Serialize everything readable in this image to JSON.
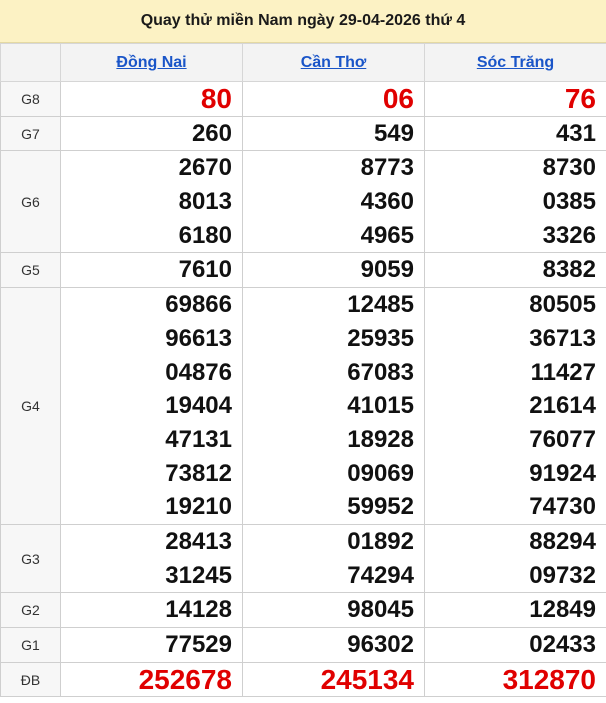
{
  "title": "Quay thử miền Nam ngày 29-04-2026 thứ 4",
  "provinces": [
    "Đồng Nai",
    "Cần Thơ",
    "Sóc Trăng"
  ],
  "accent_color": "#e00000",
  "link_color": "#1a55c8",
  "prizes": [
    {
      "label": "G8",
      "key": "g8",
      "highlight": true,
      "values": [
        [
          "80"
        ],
        [
          "06"
        ],
        [
          "76"
        ]
      ]
    },
    {
      "label": "G7",
      "key": "g7",
      "highlight": false,
      "values": [
        [
          "260"
        ],
        [
          "549"
        ],
        [
          "431"
        ]
      ]
    },
    {
      "label": "G6",
      "key": "g6",
      "highlight": false,
      "values": [
        [
          "2670",
          "8013",
          "6180"
        ],
        [
          "8773",
          "4360",
          "4965"
        ],
        [
          "8730",
          "0385",
          "3326"
        ]
      ]
    },
    {
      "label": "G5",
      "key": "g5",
      "highlight": false,
      "values": [
        [
          "7610"
        ],
        [
          "9059"
        ],
        [
          "8382"
        ]
      ]
    },
    {
      "label": "G4",
      "key": "g4",
      "highlight": false,
      "values": [
        [
          "69866",
          "96613",
          "04876",
          "19404",
          "47131",
          "73812",
          "19210"
        ],
        [
          "12485",
          "25935",
          "67083",
          "41015",
          "18928",
          "09069",
          "59952"
        ],
        [
          "80505",
          "36713",
          "11427",
          "21614",
          "76077",
          "91924",
          "74730"
        ]
      ]
    },
    {
      "label": "G3",
      "key": "g3",
      "highlight": false,
      "values": [
        [
          "28413",
          "31245"
        ],
        [
          "01892",
          "74294"
        ],
        [
          "88294",
          "09732"
        ]
      ]
    },
    {
      "label": "G2",
      "key": "g2",
      "highlight": false,
      "values": [
        [
          "14128"
        ],
        [
          "98045"
        ],
        [
          "12849"
        ]
      ]
    },
    {
      "label": "G1",
      "key": "g1",
      "highlight": false,
      "values": [
        [
          "77529"
        ],
        [
          "96302"
        ],
        [
          "02433"
        ]
      ]
    },
    {
      "label": "ĐB",
      "key": "db",
      "highlight": true,
      "values": [
        [
          "252678"
        ],
        [
          "245134"
        ],
        [
          "312870"
        ]
      ]
    }
  ]
}
